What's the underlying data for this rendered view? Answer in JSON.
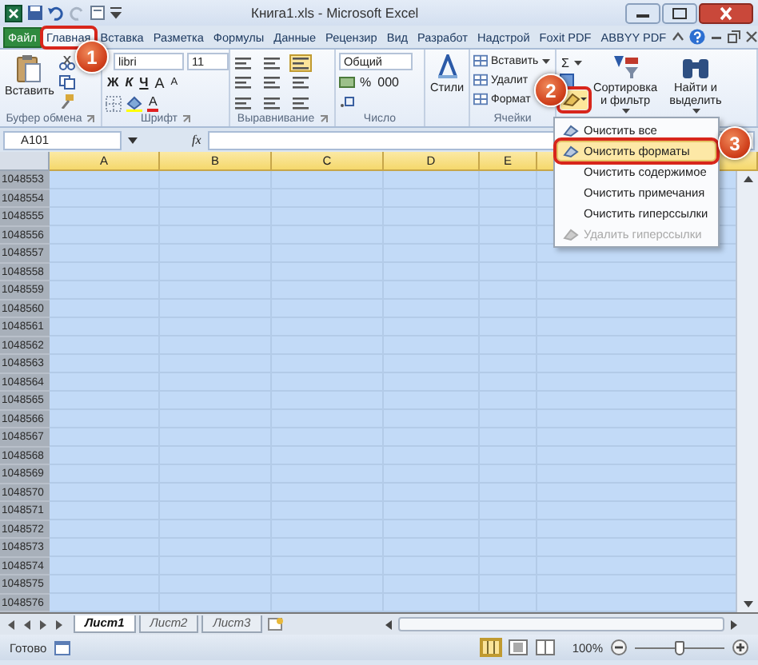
{
  "window": {
    "title": "Книга1.xls - Microsoft Excel"
  },
  "tabs": [
    {
      "label": "Файл",
      "kind": "file",
      "selected": false,
      "highlighted": false
    },
    {
      "label": "Главная",
      "kind": "tab",
      "selected": true,
      "highlighted": true
    },
    {
      "label": "Вставка",
      "kind": "tab",
      "selected": false,
      "highlighted": false
    },
    {
      "label": "Разметка",
      "kind": "tab",
      "selected": false,
      "highlighted": false
    },
    {
      "label": "Формулы",
      "kind": "tab",
      "selected": false,
      "highlighted": false
    },
    {
      "label": "Данные",
      "kind": "tab",
      "selected": false,
      "highlighted": false
    },
    {
      "label": "Рецензир",
      "kind": "tab",
      "selected": false,
      "highlighted": false
    },
    {
      "label": "Вид",
      "kind": "tab",
      "selected": false,
      "highlighted": false
    },
    {
      "label": "Разработ",
      "kind": "tab",
      "selected": false,
      "highlighted": false
    },
    {
      "label": "Надстрой",
      "kind": "tab",
      "selected": false,
      "highlighted": false
    },
    {
      "label": "Foxit PDF",
      "kind": "tab",
      "selected": false,
      "highlighted": false
    },
    {
      "label": "ABBYY PDF",
      "kind": "tab",
      "selected": false,
      "highlighted": false
    }
  ],
  "ribbon": {
    "clipboard": {
      "label": "Буфер обмена",
      "paste": "Вставить"
    },
    "font": {
      "label": "Шрифт",
      "font_name": "libri",
      "font_size": "11",
      "bold": "Ж",
      "italic": "К",
      "underline": "Ч",
      "grow": "A",
      "shrink": "A",
      "font_color_letter": "A"
    },
    "alignment": {
      "label": "Выравнивание"
    },
    "number": {
      "label": "Число",
      "format": "Общий",
      "percent": "%",
      "thousands": "000"
    },
    "styles": {
      "button": "Стили"
    },
    "cells": {
      "label": "Ячейки",
      "buttons": [
        "Вставить",
        "Удалит",
        "Формат"
      ]
    },
    "editing": {
      "sum": "Σ",
      "clear_highlighted": true,
      "sort": "Сортировка и фильтр",
      "find": "Найти и выделить"
    }
  },
  "formula_bar": {
    "name_box": "A101",
    "function_symbol": "fx"
  },
  "columns": [
    "A",
    "B",
    "C",
    "D",
    "E"
  ],
  "rows": [
    "1048553",
    "1048554",
    "1048555",
    "1048556",
    "1048557",
    "1048558",
    "1048559",
    "1048560",
    "1048561",
    "1048562",
    "1048563",
    "1048564",
    "1048565",
    "1048566",
    "1048567",
    "1048568",
    "1048569",
    "1048570",
    "1048571",
    "1048572",
    "1048573",
    "1048574",
    "1048575",
    "1048576"
  ],
  "clear_menu": [
    {
      "label": "Очистить все",
      "selected": false,
      "disabled": false,
      "highlighted": false
    },
    {
      "label": "Очистить форматы",
      "selected": true,
      "disabled": false,
      "highlighted": true
    },
    {
      "label": "Очистить содержимое",
      "selected": false,
      "disabled": false,
      "highlighted": false
    },
    {
      "label": "Очистить примечания",
      "selected": false,
      "disabled": false,
      "highlighted": false
    },
    {
      "label": "Очистить гиперссылки",
      "selected": false,
      "disabled": false,
      "highlighted": false
    },
    {
      "label": "Удалить гиперссылки",
      "selected": false,
      "disabled": true,
      "highlighted": false
    }
  ],
  "callouts": [
    {
      "number": "1"
    },
    {
      "number": "2"
    },
    {
      "number": "3"
    }
  ],
  "sheets": [
    {
      "label": "Лист1",
      "selected": true
    },
    {
      "label": "Лист2",
      "selected": false
    },
    {
      "label": "Лист3",
      "selected": false
    }
  ],
  "status_bar": {
    "status": "Готово",
    "zoom": "100%",
    "zoom_slider": {
      "level": 0.5
    }
  }
}
